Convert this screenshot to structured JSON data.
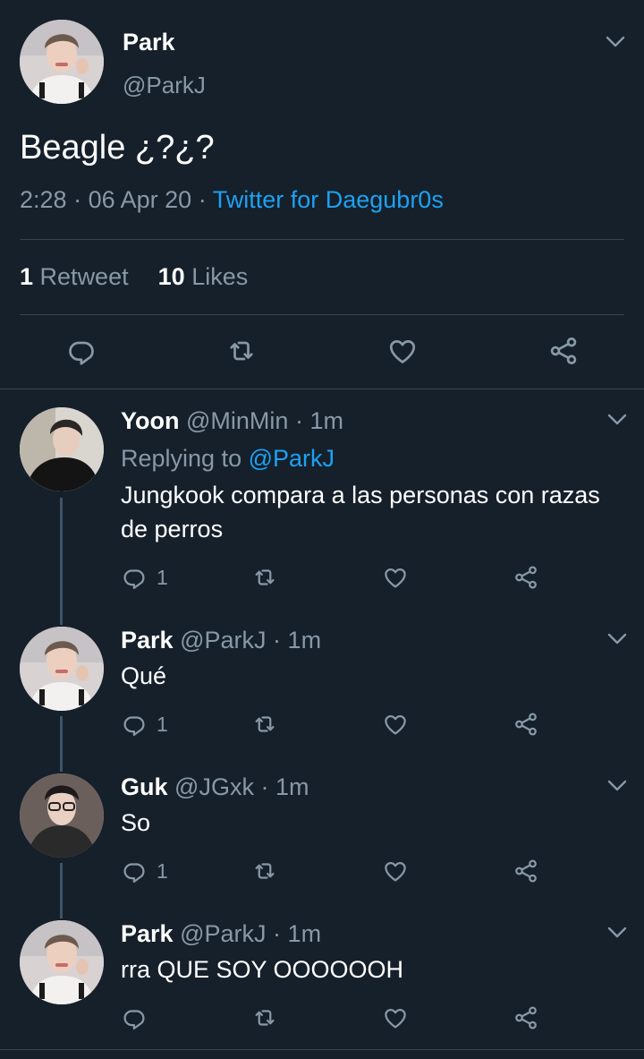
{
  "main_tweet": {
    "name": "Park",
    "handle": "@ParkJ",
    "text": "Beagle ¿?¿?",
    "time": "2:28",
    "date": "06 Apr 20",
    "source": "Twitter for Daegubr0s",
    "retweets_count": "1",
    "retweets_label": "Retweet",
    "likes_count": "10",
    "likes_label": "Likes",
    "icons": [
      "reply-icon",
      "retweet-icon",
      "like-icon",
      "share-icon"
    ]
  },
  "replies": [
    {
      "name": "Yoon",
      "handle": "@MinMin",
      "time": "1m",
      "replying_label": "Replying to",
      "replying_to": "@ParkJ",
      "text": "Jungkook compara a las personas con razas de perros",
      "reply_count": "1"
    },
    {
      "name": "Park",
      "handle": "@ParkJ",
      "time": "1m",
      "text": "Qué",
      "reply_count": "1"
    },
    {
      "name": "Guk",
      "handle": "@JGxk",
      "time": "1m",
      "text": "So",
      "reply_count": "1"
    },
    {
      "name": "Park",
      "handle": "@ParkJ",
      "time": "1m",
      "text": "rra QUE SOY OOOOOOH",
      "reply_count": ""
    }
  ],
  "separator": "·",
  "colors": {
    "background": "#15202b",
    "muted": "#8899a6",
    "link": "#1da1f2",
    "divider": "#38444d",
    "thread_line": "#3d5466"
  }
}
